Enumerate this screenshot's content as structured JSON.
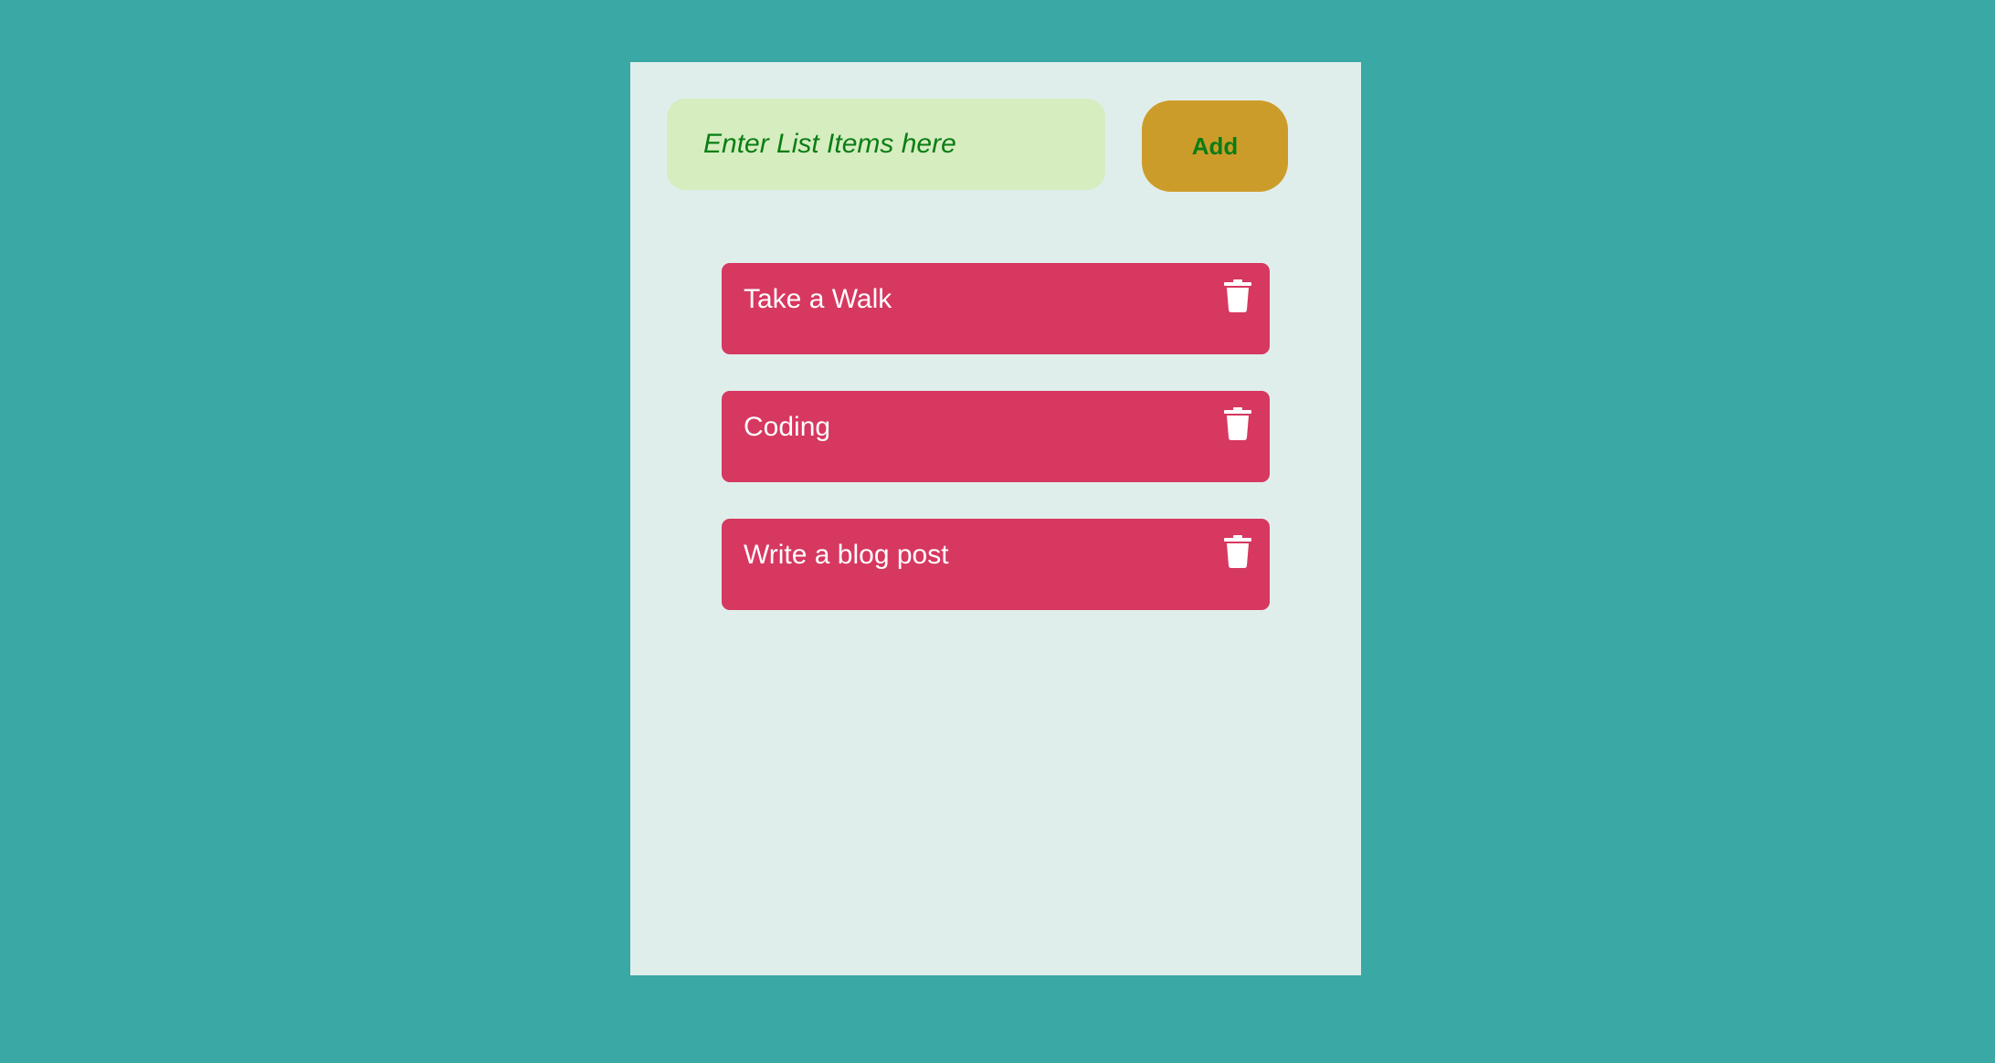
{
  "form": {
    "placeholder": "Enter List Items here",
    "value": "",
    "add_label": "Add"
  },
  "list": {
    "items": [
      {
        "label": "Take a Walk",
        "icon": "trash-icon"
      },
      {
        "label": "Coding",
        "icon": "trash-icon"
      },
      {
        "label": "Write a blog post",
        "icon": "trash-icon"
      }
    ]
  },
  "colors": {
    "background": "#3aa8a4",
    "panel": "#e0eeeb",
    "input_bg": "#d6edc0",
    "input_text": "#0a7d14",
    "button_bg": "#cc9c2a",
    "item_bg": "#d63860",
    "item_text": "#ffffff"
  }
}
